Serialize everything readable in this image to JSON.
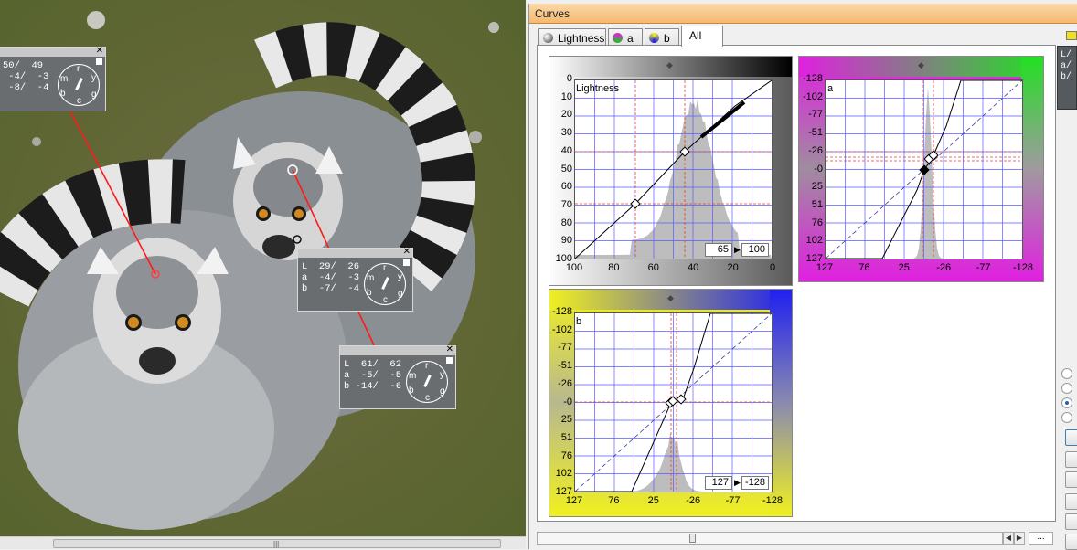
{
  "window": {
    "title": "Curves"
  },
  "tabs": [
    {
      "label": "Lightness",
      "icon": "lightness-icon"
    },
    {
      "label": "a",
      "icon": "a-channel-icon"
    },
    {
      "label": "b",
      "icon": "b-channel-icon"
    },
    {
      "label": "All",
      "active": true
    }
  ],
  "probes": [
    {
      "rows": [
        "50/  49",
        " -4/  -3",
        " -8/  -4"
      ],
      "dial": [
        "r",
        "y",
        "m",
        "b",
        "c",
        "g"
      ]
    },
    {
      "rows": [
        "L  29/  26",
        "a  -4/  -3",
        "b  -7/  -4"
      ],
      "dial": [
        "r",
        "y",
        "m",
        "b",
        "c",
        "g"
      ]
    },
    {
      "rows": [
        "L  61/  62",
        "a  -5/  -5",
        "b -14/  -6"
      ],
      "dial": [
        "r",
        "y",
        "m",
        "b",
        "c",
        "g"
      ]
    }
  ],
  "curves": {
    "lightness": {
      "name": "Lightness",
      "y_ticks": [
        "0",
        "10",
        "20",
        "30",
        "40",
        "50",
        "60",
        "70",
        "80",
        "90",
        "100"
      ],
      "x_ticks": [
        "100",
        "80",
        "60",
        "40",
        "20",
        "0"
      ],
      "input_value": "65",
      "output_value": "100"
    },
    "a": {
      "name": "a",
      "y_ticks": [
        "-128",
        "-102",
        "-77",
        "-51",
        "-26",
        "-0",
        "25",
        "51",
        "76",
        "102",
        "127"
      ],
      "x_ticks": [
        "127",
        "76",
        "25",
        "-26",
        "-77",
        "-128"
      ]
    },
    "b": {
      "name": "b",
      "y_ticks": [
        "-128",
        "-102",
        "-77",
        "-51",
        "-26",
        "-0",
        "25",
        "51",
        "76",
        "102",
        "127"
      ],
      "x_ticks": [
        "127",
        "76",
        "25",
        "-26",
        "-77",
        "-128"
      ],
      "input_value": "127",
      "output_value": "-128"
    }
  },
  "right_panel": {
    "text": [
      "L/",
      "a/",
      "b/"
    ]
  },
  "bottom": {
    "more_label": "..."
  },
  "colors": {
    "accent_title": "#f6b970",
    "grid": "#5a5aff",
    "guide": "#e04040"
  }
}
